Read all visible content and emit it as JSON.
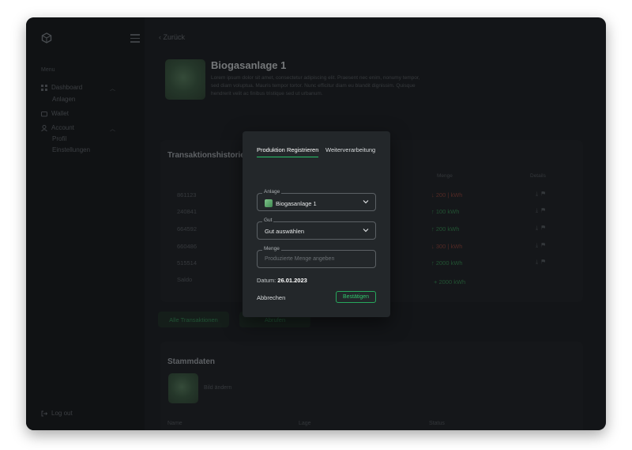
{
  "sidebar": {
    "section": "Menu",
    "items": [
      {
        "label": "Dashboard"
      },
      {
        "label": "Anlagen"
      },
      {
        "label": "Wallet"
      },
      {
        "label": "Account"
      },
      {
        "label": "Profil"
      },
      {
        "label": "Einstellungen"
      }
    ],
    "logout": "Log out"
  },
  "header": {
    "back": "Zurück",
    "title": "Biogasanlage 1",
    "description": "Lorem ipsum dolor sit amet, consectetur adipiscing elit. Praesent nec enim, nonumy tempor, sed diam voluptua. Mauris tempor tortor. Nunc efficitur diam eu blandit dignissim. Quisque hendrerit velit ac finibus tristique sed ut urbanum."
  },
  "transactions": {
    "title": "Transaktionshistorie",
    "col_amount": "Menge",
    "col_details": "Details",
    "rows": [
      {
        "id": "861123",
        "amount": "↓ 200 | kWh",
        "dir": "out"
      },
      {
        "id": "240841",
        "amount": "↑ 100 kWh",
        "dir": "in"
      },
      {
        "id": "664592",
        "amount": "↑ 200 kWh",
        "dir": "in"
      },
      {
        "id": "660486",
        "amount": "↓ 300 | kWh",
        "dir": "out"
      },
      {
        "id": "515514",
        "amount": "↑ 2000 kWh",
        "dir": "in"
      }
    ],
    "sum_label": "Saldo",
    "sum_value": "+ 2000 kWh",
    "btn_all": "Alle Transaktionen",
    "btn_export": "Abrufen"
  },
  "stammdaten": {
    "title": "Stammdaten",
    "image_label": "Bild ändern",
    "col_name": "Name",
    "col_location": "Lage",
    "col_status": "Status"
  },
  "modal": {
    "tab_active": "Produktion Registrieren",
    "tab_other": "Weiterverarbeitung",
    "anlage_legend": "Anlage",
    "anlage_value": "Biogasanlage 1",
    "gut_legend": "Gut",
    "gut_value": "Gut auswählen",
    "menge_legend": "Menge",
    "menge_placeholder": "Produzierte Menge angeben",
    "date_label": "Datum:",
    "date_value": "26.01.2023",
    "cancel": "Abbrechen",
    "confirm": "Bestätigen"
  },
  "colors": {
    "accent": "#27c26a",
    "background": "#1a1d1f",
    "modal": "#23272a"
  }
}
